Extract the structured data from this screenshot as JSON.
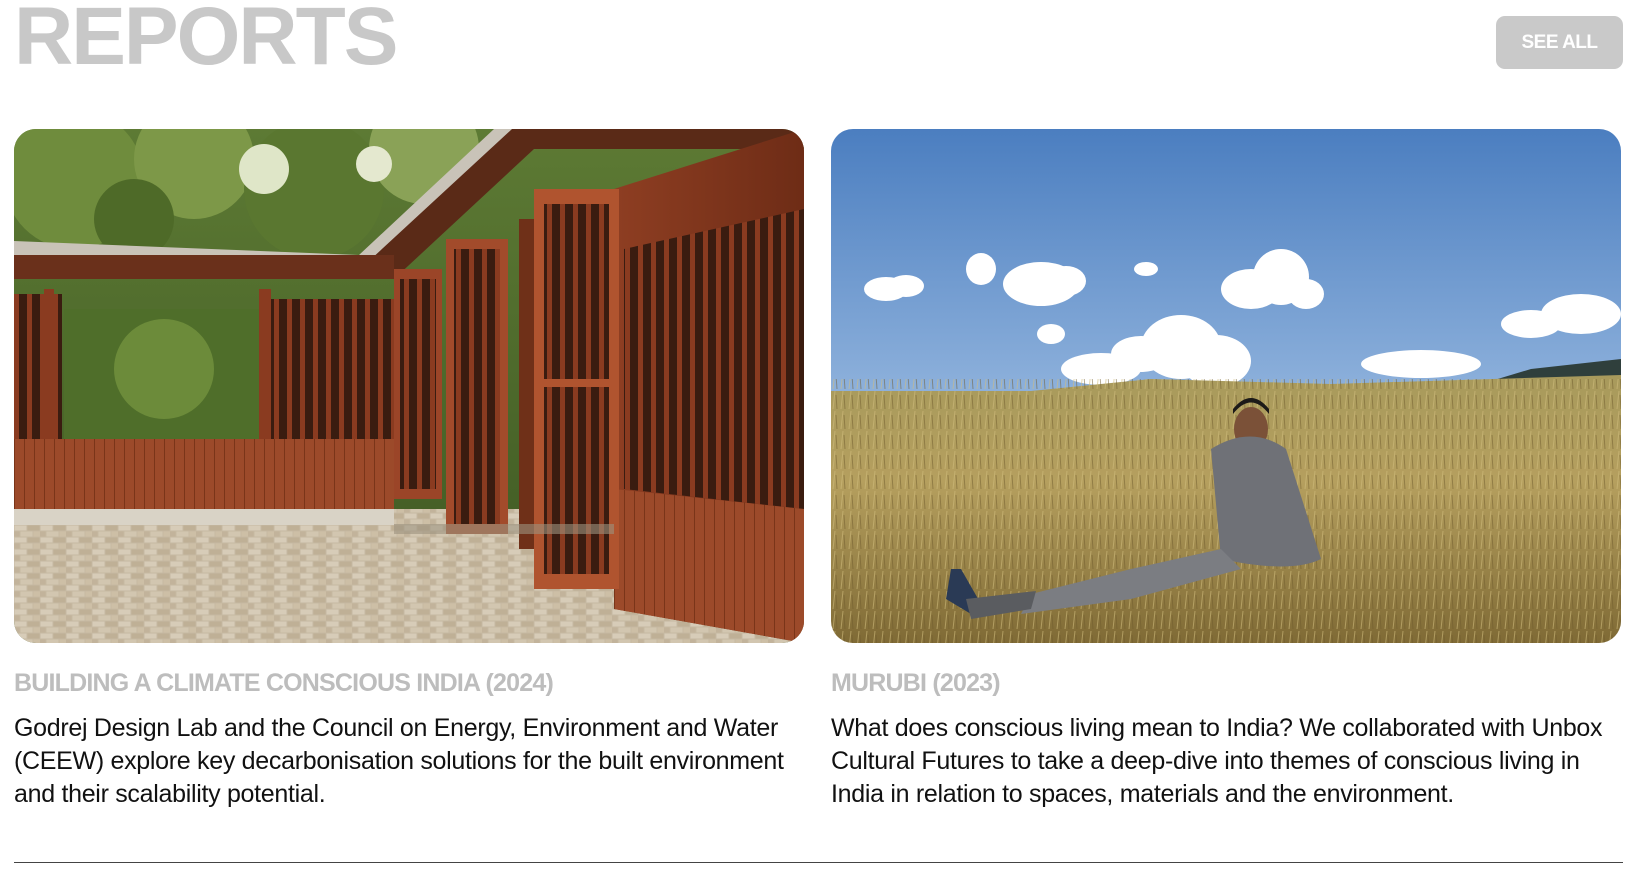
{
  "section": {
    "title": "REPORTS",
    "see_all_label": "SEE ALL"
  },
  "reports": [
    {
      "title": "BUILDING A CLIMATE CONSCIOUS INDIA (2024)",
      "description": "Godrej Design Lab and the Council on Energy, Environment and Water (CEEW) explore key decarbonisation solutions for the built environment and their scalability potential.",
      "image": "wooden-pavilion-photo"
    },
    {
      "title": "MURUBI (2023)",
      "description": "What does conscious living mean to India? We collaborated with Unbox Cultural Futures to take a deep-dive into themes of conscious living in India in relation to spaces, materials and the environment.",
      "image": "man-sitting-in-meadow-photo"
    }
  ],
  "colors": {
    "title_gray": "#c8c8c8",
    "button_gray": "#c9c9c9",
    "card_title_gray": "#bdbdbd",
    "body_text": "#111111"
  }
}
